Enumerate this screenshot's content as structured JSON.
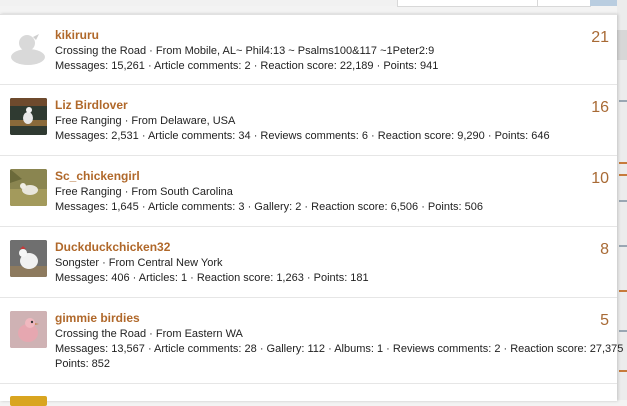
{
  "members": [
    {
      "username": "kikiruru",
      "title_line": "Crossing the Road · From Mobile, AL~ Phil4:13 ~ Psalms100&117 ~1Peter2:9",
      "stats_line": "Messages: 15,261 · Article comments: 2 · Reaction score: 22,189 · Points: 941",
      "stats_line2": "",
      "score": "21",
      "avatar": "default-avatar-icon"
    },
    {
      "username": "Liz Birdlover",
      "title_line": "Free Ranging · From Delaware, USA",
      "stats_line": "Messages: 2,531 · Article comments: 34 · Reviews comments: 6 · Reaction score: 9,290 · Points: 646",
      "stats_line2": "",
      "score": "16",
      "avatar": "bird-photo"
    },
    {
      "username": "Sc_chickengirl",
      "title_line": "Free Ranging · From South Carolina",
      "stats_line": "Messages: 1,645 · Article comments: 3 · Gallery: 2 · Reaction score: 6,506 · Points: 506",
      "stats_line2": "",
      "score": "10",
      "avatar": "chicken-grass-photo"
    },
    {
      "username": "Duckduckchicken32",
      "title_line": "Songster · From Central New York",
      "stats_line": "Messages: 406 · Articles: 1 · Reaction score: 1,263 · Points: 181",
      "stats_line2": "",
      "score": "8",
      "avatar": "white-chicken-photo"
    },
    {
      "username": "gimmie birdies",
      "title_line": "Crossing the Road · From Eastern WA",
      "stats_line": "Messages: 13,567 · Article comments: 28 · Gallery: 112 · Albums: 1 · Reviews comments: 2 · Reaction score: 27,375 ·",
      "stats_line2": "Points: 852",
      "score": "5",
      "avatar": "pink-bird-photo"
    }
  ],
  "partial_next": {
    "username_fragment": "",
    "avatar": "yellow-avatar-photo"
  },
  "colors": {
    "username": "#b0682a",
    "score": "#a86a35",
    "text": "#222222",
    "divider": "#e6e6e6"
  }
}
